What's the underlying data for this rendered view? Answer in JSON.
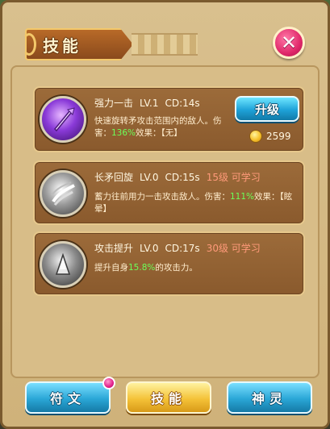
{
  "panel": {
    "title": "技能",
    "close_label": "✕"
  },
  "skills": [
    {
      "name": "强力一击",
      "level": "LV.1",
      "cd": "CD:14s",
      "unlock": "",
      "desc_prefix": "快速旋转矛攻击范围内的敌人。伤害：",
      "desc_value": "136%",
      "desc_suffix": "效果：【无】",
      "icon": "purple-spear-icon"
    },
    {
      "name": "长矛回旋",
      "level": "LV.0",
      "cd": "CD:15s",
      "unlock": "15级 可学习",
      "desc_prefix": "蓄力往前用力一击攻击敌人。伤害：",
      "desc_value": "111%",
      "desc_suffix": "效果：【眩晕】",
      "icon": "spear-spin-icon"
    },
    {
      "name": "攻击提升",
      "level": "LV.0",
      "cd": "CD:17s",
      "unlock": "30级 可学习",
      "desc_prefix": "提升自身",
      "desc_value": "15.8%",
      "desc_suffix": "的攻击力。",
      "icon": "attack-up-icon"
    }
  ],
  "upgrade": {
    "label": "升级",
    "cost": "2599"
  },
  "tabs": [
    {
      "label": "符文",
      "active": false
    },
    {
      "label": "技能",
      "active": true
    },
    {
      "label": "神灵",
      "active": false
    }
  ],
  "colors": {
    "highlight_green": "#6cff5a",
    "unlock_red": "#ff9a7a",
    "card_brown": "#8a5a2d",
    "button_blue": "#1ea2d8",
    "tab_gold": "#f4c238",
    "close_pink": "#e0286a"
  }
}
